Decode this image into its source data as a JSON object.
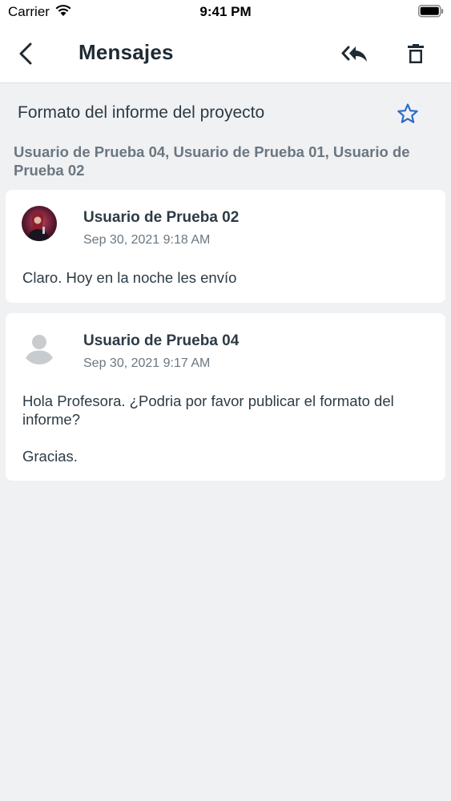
{
  "status_bar": {
    "carrier": "Carrier",
    "time": "9:41 PM"
  },
  "nav": {
    "title": "Mensajes"
  },
  "conversation": {
    "subject": "Formato del informe del proyecto",
    "participants": "Usuario de Prueba 04, Usuario de Prueba 01, Usuario de Prueba 02"
  },
  "messages": [
    {
      "author": "Usuario de Prueba 02",
      "date": "Sep 30, 2021 9:18 AM",
      "body": "Claro. Hoy en la noche les envío"
    },
    {
      "author": "Usuario de Prueba 04",
      "date": "Sep 30, 2021 9:17 AM",
      "body": "Hola Profesora. ¿Podria por favor publicar el formato del informe?\n\nGracias."
    }
  ],
  "icons": {
    "back": "chevron-left-icon",
    "reply_all": "reply-all-icon",
    "delete": "trash-icon",
    "star": "star-outline-icon",
    "default_avatar": "person-silhouette-icon"
  },
  "colors": {
    "accent": "#2b6cc4",
    "background": "#f0f1f3",
    "text": "#2d3b45",
    "muted": "#6b7780"
  }
}
